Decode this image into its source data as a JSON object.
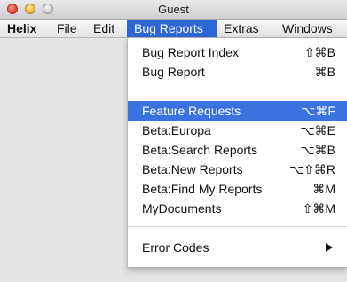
{
  "window": {
    "title": "Guest"
  },
  "menubar": {
    "items": [
      {
        "label": "Helix"
      },
      {
        "label": "File"
      },
      {
        "label": "Edit"
      },
      {
        "label": "Bug Reports"
      },
      {
        "label": "Extras"
      },
      {
        "label": "Windows"
      }
    ]
  },
  "dropdown": {
    "items": [
      {
        "label": "Bug Report Index",
        "shortcut": "⇧⌘B"
      },
      {
        "label": "Bug Report",
        "shortcut": "⌘B"
      },
      {
        "label": "Feature Requests",
        "shortcut": "⌥⌘F"
      },
      {
        "label": "Beta:Europa",
        "shortcut": "⌥⌘E"
      },
      {
        "label": "Beta:Search Reports",
        "shortcut": "⌥⌘B"
      },
      {
        "label": "Beta:New Reports",
        "shortcut": "⌥⇧⌘R"
      },
      {
        "label": "Beta:Find My Reports",
        "shortcut": "⌘M"
      },
      {
        "label": "MyDocuments",
        "shortcut": "⇧⌘M"
      },
      {
        "label": "Error Codes",
        "shortcut": ""
      }
    ],
    "highlighted_index": 2
  }
}
